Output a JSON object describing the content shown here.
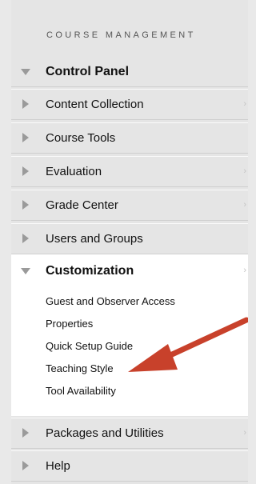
{
  "section_title": "COURSE MANAGEMENT",
  "control_panel": {
    "label": "Control Panel",
    "icon": "triangle-down-icon"
  },
  "menu_items_top": [
    {
      "label": "Content Collection",
      "has_chevron": true
    },
    {
      "label": "Course Tools",
      "has_chevron": false
    },
    {
      "label": "Evaluation",
      "has_chevron": true
    },
    {
      "label": "Grade Center",
      "has_chevron": true
    },
    {
      "label": "Users and Groups",
      "has_chevron": false
    }
  ],
  "customization": {
    "label": "Customization",
    "children": [
      "Guest and Observer Access",
      "Properties",
      "Quick Setup Guide",
      "Teaching Style",
      "Tool Availability"
    ]
  },
  "menu_items_bottom": [
    {
      "label": "Packages and Utilities",
      "has_chevron": true
    },
    {
      "label": "Help",
      "has_chevron": false
    }
  ],
  "chevron_glyph": "›",
  "colors": {
    "arrow": "#c8412b",
    "panel": "#e5e5e5",
    "expanded_bg": "#ffffff"
  }
}
